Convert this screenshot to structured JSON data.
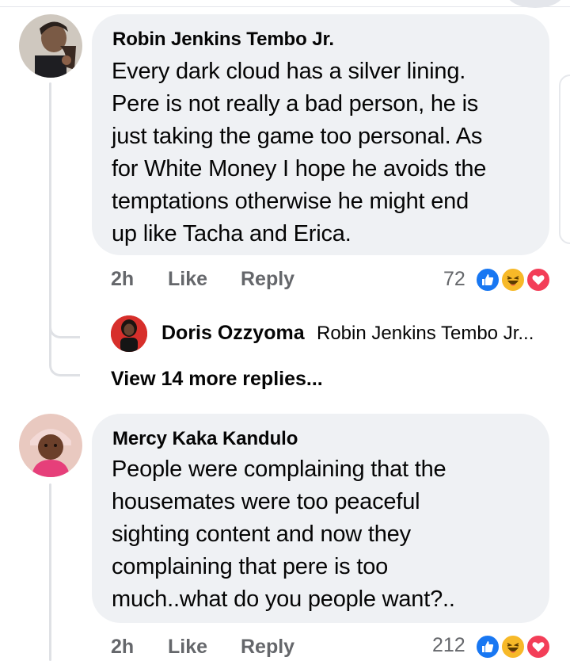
{
  "comments": [
    {
      "author": "Robin Jenkins Tembo Jr.",
      "text": "Every dark cloud has a silver lining.\nPere is not really a bad person, he is\njust taking the game too personal. As\nfor White Money I hope he avoids the\ntemptations otherwise he might end\nup like Tacha and Erica.",
      "time": "2h",
      "like_label": "Like",
      "reply_label": "Reply",
      "reaction_count": "72",
      "reactions": [
        "like",
        "haha",
        "love"
      ],
      "reply_preview": {
        "author": "Doris Ozzyoma",
        "snippet": "Robin Jenkins Tembo Jr..."
      },
      "view_more_label": "View 14 more replies..."
    },
    {
      "author": "Mercy Kaka Kandulo",
      "text": "People were complaining that the\nhousemates were too peaceful\nsighting content and now they\ncomplaining that pere is too\nmuch..what do you people want?..",
      "time": "2h",
      "like_label": "Like",
      "reply_label": "Reply",
      "reaction_count": "212",
      "reactions": [
        "like",
        "haha",
        "love"
      ]
    }
  ],
  "colors": {
    "bubble": "#eff1f4",
    "meta_text": "#65676b",
    "like_blue": "#1877f2",
    "haha_yellow": "#f7b928",
    "love_red": "#f33e58"
  }
}
